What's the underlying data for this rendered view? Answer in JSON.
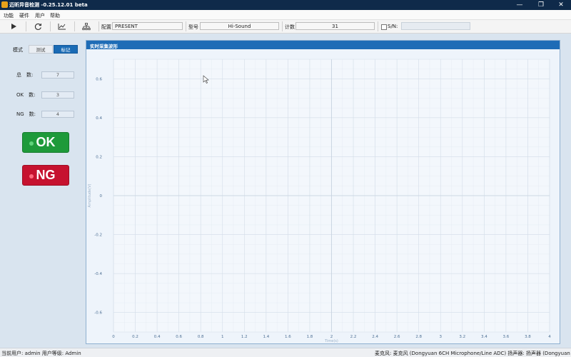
{
  "window": {
    "title": "迈昕异音检测 -0.25.12.01 beta",
    "controls": [
      "—",
      "❐",
      "✕"
    ]
  },
  "menu": [
    "功能",
    "硬件",
    "用户",
    "帮助"
  ],
  "toolbar": {
    "icons": [
      "play-icon",
      "refresh-icon",
      "chart-icon",
      "network-icon"
    ],
    "config_label": "配置",
    "config_value": "PRESENT",
    "model_label": "型号",
    "model_value": "Hi-Sound",
    "count_label": "计数",
    "count_value": "31",
    "sn_label": "S/N:",
    "sn_value": ""
  },
  "left": {
    "mode_label": "模式",
    "mode_test": "测试",
    "mode_mark": "标记",
    "total_label": "总　数:",
    "total_value": "7",
    "ok_label": "OK　数:",
    "ok_value": "3",
    "ng_label": "NG　数:",
    "ng_value": "4",
    "ok_button": "OK",
    "ng_button": "NG"
  },
  "chart_title": "实时采集波形",
  "chart_data": {
    "type": "line",
    "title": "实时采集波形",
    "xlabel": "Time(s)",
    "ylabel": "Amplitude(V)",
    "xlim": [
      0,
      4
    ],
    "ylim": [
      -0.7,
      0.7
    ],
    "xticks": [
      "0",
      "0.2",
      "0.4",
      "0.6",
      "0.8",
      "1",
      "1.2",
      "1.4",
      "1.6",
      "1.8",
      "2",
      "2.2",
      "2.4",
      "2.6",
      "2.8",
      "3",
      "3.2",
      "3.4",
      "3.6",
      "3.8",
      "4"
    ],
    "yticks": [
      "0.6",
      "0.4",
      "0.2",
      "0",
      "-0.2",
      "-0.4",
      "-0.6"
    ],
    "series": [],
    "grid": true
  },
  "status": {
    "user": "当前用户: admin  用户等级: Admin",
    "devices": "麦克风: 麦克风 (Dongyuan 6CH Microphone/Line ADC)  扬声器: 扬声器 (Dongyuan Speaker)"
  },
  "colors": {
    "titlebar": "#0f2a4a",
    "accent": "#1e6cb6",
    "ok": "#1e9a3a",
    "ng": "#c6122f"
  }
}
